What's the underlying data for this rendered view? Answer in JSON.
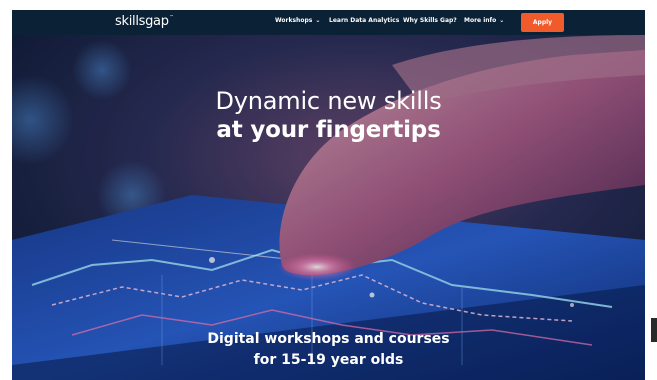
{
  "nav": {
    "logo": "skillsgap",
    "logo_mark": "™",
    "items": [
      {
        "label": "Workshops",
        "chevron": true
      },
      {
        "label": "Learn Data Analytics",
        "chevron": false
      },
      {
        "label": "Why Skills Gap?",
        "chevron": false
      },
      {
        "label": "More info",
        "chevron": true
      }
    ],
    "chevron_glyph": "⌄",
    "apply_label": "Apply"
  },
  "hero": {
    "headline_line1": "Dynamic new skills",
    "headline_line2": "at your fingertips",
    "subhead_line1": "Digital workshops and courses",
    "subhead_line2": "for 15-19 year olds",
    "image": "finger touching smartphone screen with glowing charts"
  },
  "colors": {
    "nav_bg": "#0b2136",
    "accent": "#f15a2b",
    "text": "#ffffff"
  }
}
